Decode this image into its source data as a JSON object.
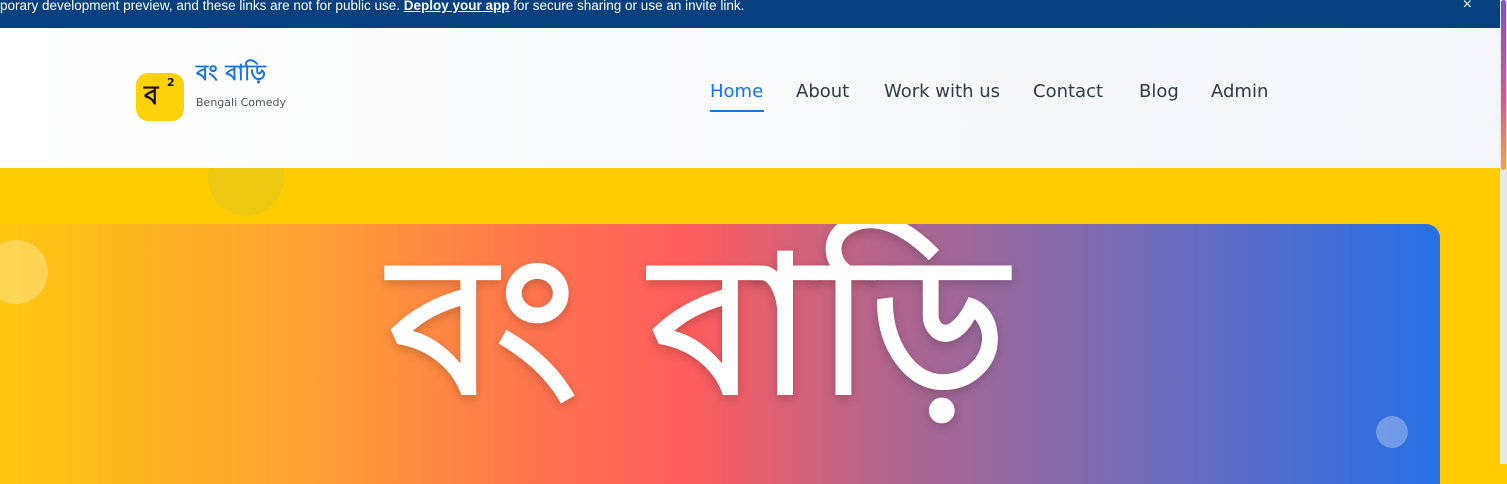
{
  "banner": {
    "text_before": "porary development preview, and these links are not for public use. ",
    "link": "Deploy your app",
    "text_after": " for secure sharing or use an invite link.",
    "close_glyph": "×"
  },
  "brand": {
    "logo_glyph": "ব",
    "logo_sup": "2",
    "name": "বং বাড়ি",
    "tagline": "Bengali Comedy",
    "accent_color": "#1673e6",
    "logo_color": "#fdd20a"
  },
  "nav": {
    "items": [
      {
        "label": "Home",
        "active": true
      },
      {
        "label": "About"
      },
      {
        "label": "Work with us"
      },
      {
        "label": "Contact"
      },
      {
        "label": "Blog"
      },
      {
        "label": "Admin"
      }
    ]
  },
  "hero": {
    "title": "বং বাড়ি",
    "background_color": "#fecb00"
  }
}
